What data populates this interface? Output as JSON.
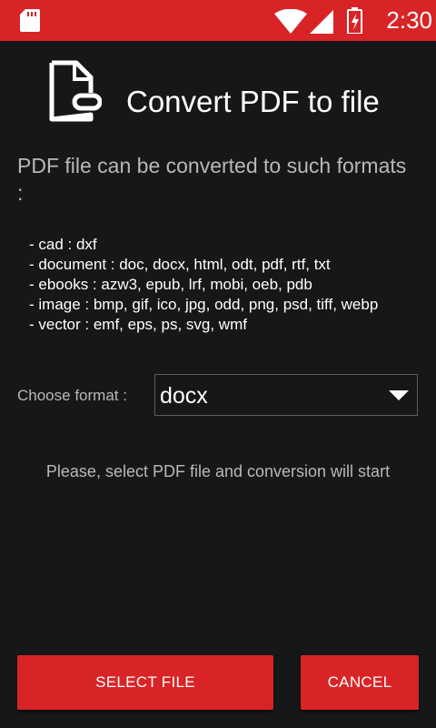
{
  "status_bar": {
    "time": "2:30",
    "icons": [
      "sd-card-icon",
      "wifi-icon",
      "cell-signal-icon",
      "battery-charging-icon"
    ]
  },
  "header": {
    "title": "Convert PDF to file",
    "icon": "document-icon"
  },
  "intro": {
    "text": "PDF file can be converted to such formats :"
  },
  "formats": [
    "- cad : dxf",
    "- document : doc, docx, html, odt, pdf, rtf, txt",
    "- ebooks : azw3, epub, lrf, mobi, oeb, pdb",
    "- image : bmp, gif, ico, jpg, odd, png, psd, tiff, webp",
    "- vector : emf, eps, ps, svg, wmf"
  ],
  "chooser": {
    "label": "Choose format :",
    "selected": "docx"
  },
  "hint": "Please, select PDF file and conversion will start",
  "buttons": {
    "select_file": "SELECT FILE",
    "cancel": "CANCEL"
  },
  "colors": {
    "accent": "#d82427",
    "background": "#161718",
    "secondary_text": "#b8b8b8",
    "primary_text": "#ffffff"
  }
}
